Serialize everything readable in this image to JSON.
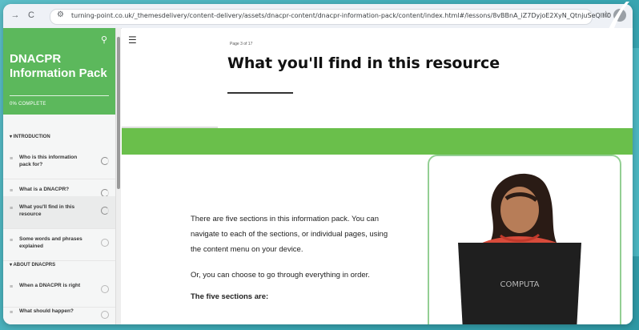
{
  "browser": {
    "back_icon": "back-arrow-icon",
    "reload_icon": "reload-icon",
    "url": "turning-point.co.uk/_themesdelivery/content-delivery/assets/dnacpr-content/dnacpr-information-pack/content/index.html#/lessons/8vBBnA_iZ7DyjoE2XyN_QtnjuSeQlH0",
    "star_icon": "bookmark-star-icon"
  },
  "sidebar": {
    "title": "DNACPR Information Pack",
    "progress": "0% COMPLETE",
    "sections": [
      {
        "label": "INTRODUCTION"
      },
      {
        "label": "ABOUT DNACPRS"
      }
    ],
    "lessons": [
      {
        "label": "Who is this information pack for?",
        "status": "in-progress",
        "active": false
      },
      {
        "label": "What is a DNACPR?",
        "status": "in-progress",
        "active": false
      },
      {
        "label": "What you'll find in this resource",
        "status": "in-progress",
        "active": true
      },
      {
        "label": "Some words and phrases explained",
        "status": "not-started",
        "active": false
      },
      {
        "label": "When a DNACPR is right",
        "status": "not-started",
        "active": false
      },
      {
        "label": "What should happen?",
        "status": "not-started",
        "active": false
      }
    ]
  },
  "main": {
    "page_counter": "Page 3 of 17",
    "title": "What you'll find in this resource",
    "paragraph1": "There are five sections in this information pack. You can navigate to each of the sections, or individual pages, using the content menu on your device.",
    "paragraph2": "Or, you can choose to go through everything in order.",
    "paragraph3": "The five sections are:",
    "laptop_brand": "COMPUTA"
  },
  "colors": {
    "accent_green": "#5cb85c",
    "band_green": "#6abf4b",
    "card_border": "#93cf93",
    "backdrop": "#39a9b6"
  }
}
